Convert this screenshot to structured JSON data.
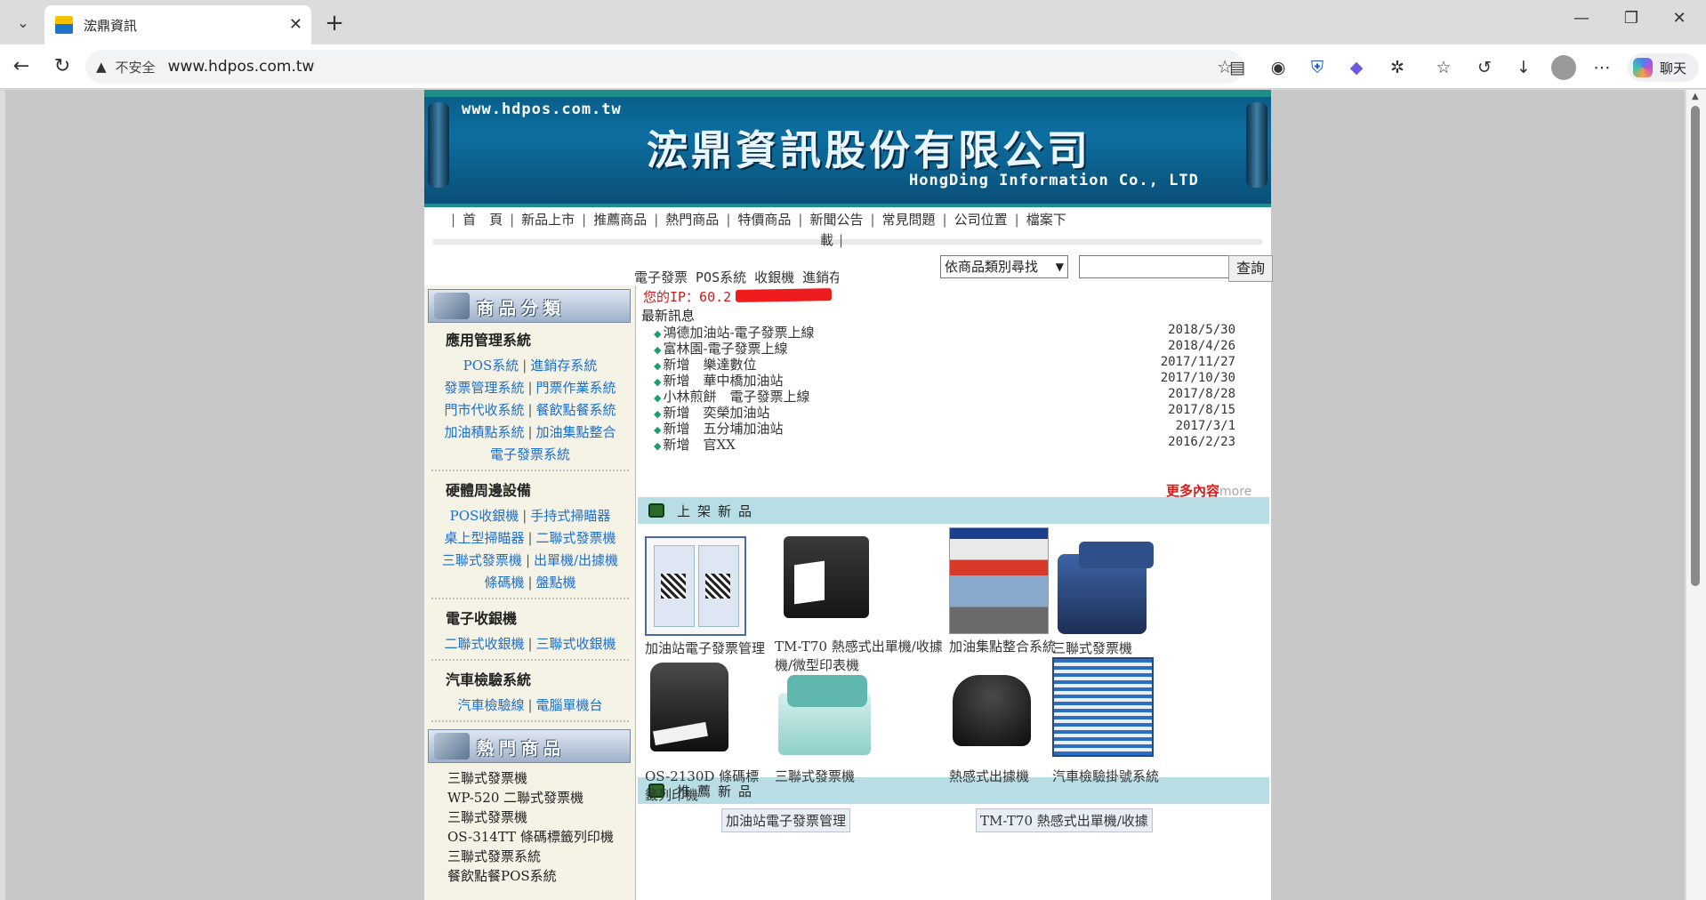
{
  "browser": {
    "tab_title": "浤鼎資訊",
    "tab_favicon_text": "Hong Ding",
    "insecure_label": "不安全",
    "url": "www.hdpos.com.tw",
    "chat_label": "聊天"
  },
  "banner": {
    "url": "www.hdpos.com.tw",
    "title": "浤鼎資訊股份有限公司",
    "english": "HongDing Information Co., LTD"
  },
  "nav": {
    "items": [
      "首　頁",
      "新品上市",
      "推薦商品",
      "熱門商品",
      "特價商品",
      "新聞公告",
      "常見問題",
      "公司位置",
      "檔案下"
    ],
    "wrap": "載"
  },
  "search": {
    "ticker": "電子發票 POS系統 收銀機 進銷存",
    "select_value": "依商品類別尋找",
    "button": "查詢"
  },
  "sidebar": {
    "category_header": "商品分類",
    "categories": [
      {
        "title": "應用管理系統",
        "rows": [
          [
            "POS系統",
            "進銷存系統"
          ],
          [
            "發票管理系統",
            "門票作業系統"
          ],
          [
            "門市代收系統",
            "餐飲點餐系統"
          ],
          [
            "加油積點系統",
            "加油集點整合"
          ],
          [
            "電子發票系統"
          ]
        ]
      },
      {
        "title": "硬體周邊設備",
        "rows": [
          [
            "POS收銀機",
            "手持式掃瞄器"
          ],
          [
            "桌上型掃瞄器",
            "二聯式發票機"
          ],
          [
            "三聯式發票機",
            "出單機/出據機"
          ],
          [
            "條碼機",
            "盤點機"
          ]
        ]
      },
      {
        "title": "電子收銀機",
        "rows": [
          [
            "二聯式收銀機",
            "三聯式收銀機"
          ]
        ]
      },
      {
        "title": "汽車檢驗系統",
        "rows": [
          [
            "汽車檢驗線",
            "電腦單機台"
          ]
        ]
      }
    ],
    "hot_header": "熱門商品",
    "hot_items": [
      "三聯式發票機",
      "WP-520 二聯式發票機",
      "三聯式發票機",
      "OS-314TT 條碼標籤列印機",
      "三聯式發票系統",
      "餐飲點餐POS系統"
    ]
  },
  "main": {
    "ip_label": "您的IP：60.2",
    "news_title": "最新訊息",
    "news": [
      {
        "text": "鴻德加油站-電子發票上線",
        "date": "2018/5/30"
      },
      {
        "text": "富林園-電子發票上線",
        "date": "2018/4/26"
      },
      {
        "text": "新增　樂達數位",
        "date": "2017/11/27"
      },
      {
        "text": "新增　華中橋加油站",
        "date": "2017/10/30"
      },
      {
        "text": "小林煎餅　電子發票上線",
        "date": "2017/8/28"
      },
      {
        "text": "新增　奕榮加油站",
        "date": "2017/8/15"
      },
      {
        "text": "新增　五分埔加油站",
        "date": "2017/3/1"
      },
      {
        "text": "新增　官XX",
        "date": "2016/2/23"
      }
    ],
    "more_label": "更多內容",
    "more_ghost": "more",
    "new_section": "上架新品",
    "new_products": [
      {
        "caption": "加油站電子發票管理"
      },
      {
        "caption": "TM-T70 熱感式出單機/收據機/微型印表機"
      },
      {
        "caption": "加油集點整合系統"
      },
      {
        "caption": "三聯式發票機"
      },
      {
        "caption": "OS-2130D 條碼標籤列印機"
      },
      {
        "caption": "三聯式發票機"
      },
      {
        "caption": "熱感式出據機"
      },
      {
        "caption": "汽車檢驗掛號系統"
      }
    ],
    "rec_section": "推薦新品",
    "rec_products": [
      "加油站電子發票管理",
      "TM-T70 熱感式出單機/收據"
    ]
  }
}
